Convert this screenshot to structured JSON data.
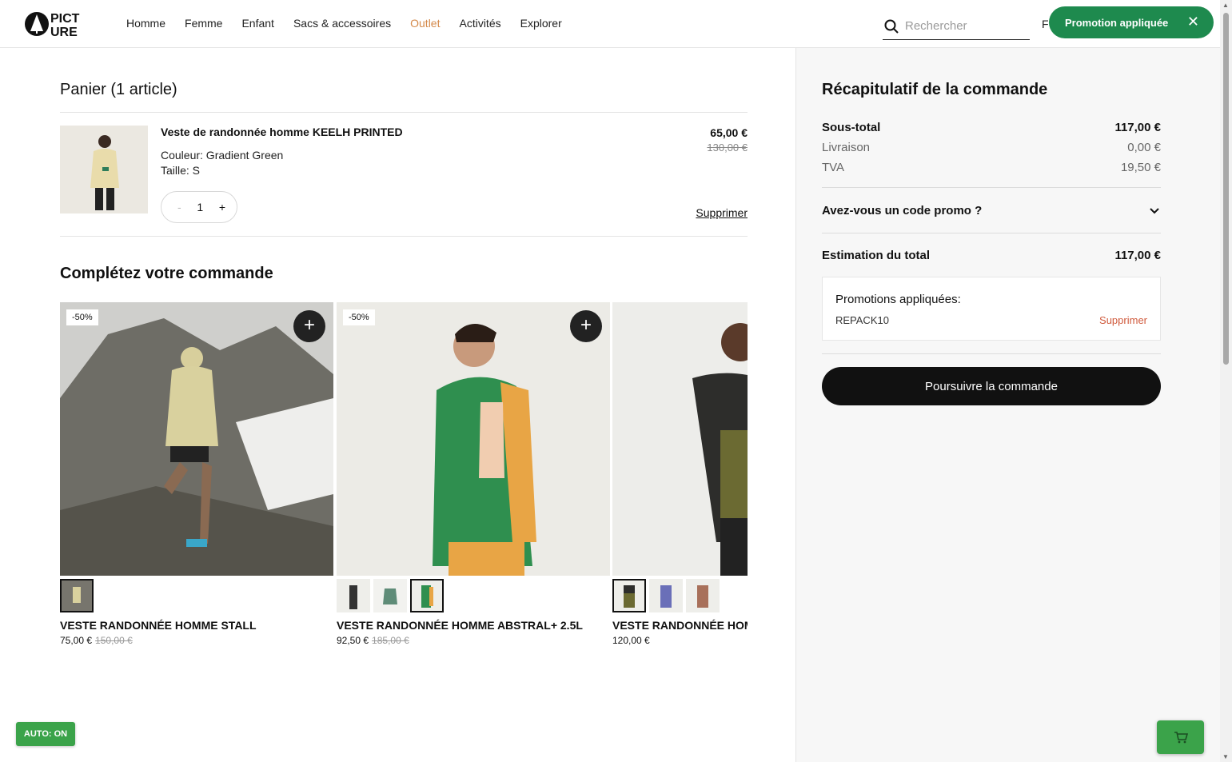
{
  "header": {
    "logo_line1": "PICT",
    "logo_line2": "URE",
    "nav": [
      "Homme",
      "Femme",
      "Enfant",
      "Sacs & accessoires",
      "Outlet",
      "Activités",
      "Explorer"
    ],
    "search_placeholder": "Rechercher",
    "lang": "F",
    "promo_pill": "Promotion appliquée"
  },
  "cart": {
    "title": "Panier (1 article)",
    "item": {
      "name": "Veste de randonnée homme KEELH PRINTED",
      "color": "Couleur: Gradient Green",
      "size": "Taille: S",
      "qty": "1",
      "qty_minus": "-",
      "qty_plus": "+",
      "price": "65,00 €",
      "old_price": "130,00 €",
      "remove": "Supprimer"
    }
  },
  "complete": {
    "title": "Complétez votre commande",
    "products": [
      {
        "name": "VESTE RANDONNÉE HOMME STALL",
        "price": "75,00 €",
        "old_price": "150,00 €",
        "badge": "-50%"
      },
      {
        "name": "VESTE RANDONNÉE HOMME ABSTRAL+ 2.5L",
        "price": "92,50 €",
        "old_price": "185,00 €",
        "badge": "-50%"
      },
      {
        "name": "VESTE RANDONNÉE HOMME",
        "price": "120,00 €",
        "old_price": "",
        "badge": ""
      }
    ]
  },
  "summary": {
    "title": "Récapitulatif de la commande",
    "subtotal_label": "Sous-total",
    "subtotal": "117,00 €",
    "shipping_label": "Livraison",
    "shipping": "0,00 €",
    "tax_label": "TVA",
    "tax": "19,50 €",
    "promo_question": "Avez-vous un code promo ?",
    "total_label": "Estimation du total",
    "total": "117,00 €",
    "promos_title": "Promotions appliquées:",
    "promo_code": "REPACK10",
    "promo_remove": "Supprimer",
    "checkout": "Poursuivre la commande"
  },
  "widgets": {
    "auto": "AUTO: ON"
  },
  "colors": {
    "accent_green": "#1e8a4e",
    "outlet": "#d4894a",
    "remove_red": "#d05a3c"
  }
}
